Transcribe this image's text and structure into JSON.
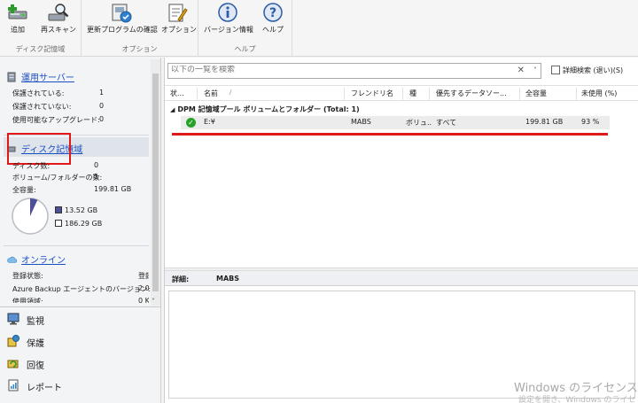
{
  "ribbon": {
    "groups": [
      {
        "caption": "ディスク記憶域",
        "buttons": [
          {
            "label": "追加",
            "icon": "add-disk-icon"
          },
          {
            "label": "再スキャン",
            "icon": "rescan-icon"
          }
        ]
      },
      {
        "caption": "オプション",
        "buttons": [
          {
            "label": "更新プログラムの確認",
            "icon": "check-updates-icon"
          },
          {
            "label": "オプション",
            "icon": "options-icon"
          }
        ]
      },
      {
        "caption": "ヘルプ",
        "buttons": [
          {
            "label": "バージョン情報",
            "icon": "info-icon"
          },
          {
            "label": "ヘルプ",
            "icon": "help-icon"
          }
        ]
      }
    ]
  },
  "left": {
    "servers": {
      "title": "運用サーバー",
      "rows": [
        {
          "label": "保護されている:",
          "value": "1"
        },
        {
          "label": "保護されていない:",
          "value": "0"
        },
        {
          "label": "使用可能なアップグレード:",
          "value": "0"
        }
      ]
    },
    "disk": {
      "title": "ディスク記憶域",
      "rows": [
        {
          "label": "ディスク数:",
          "value": "0"
        },
        {
          "label": "ボリューム/フォルダーの数:",
          "value": "1"
        },
        {
          "label": "全容量:",
          "value": "199.81 GB"
        }
      ],
      "used_label": "13.52 GB",
      "free_label": "186.29 GB",
      "used_fraction": 0.068,
      "used_color": "#4e4f9a"
    },
    "online": {
      "title": "オンライン",
      "rows": [
        {
          "label": "登録状態:",
          "value": "登録"
        },
        {
          "label": "Azure Backup エージェントのバージョン:",
          "value": "2.0"
        },
        {
          "label": "使用領域:",
          "value": "0 K"
        }
      ]
    },
    "nav": [
      {
        "label": "監視",
        "icon": "monitor-icon"
      },
      {
        "label": "保護",
        "icon": "protection-icon"
      },
      {
        "label": "回復",
        "icon": "recovery-icon"
      },
      {
        "label": "レポート",
        "icon": "report-icon"
      }
    ]
  },
  "main": {
    "search_placeholder": "以下の一覧を検索",
    "advanced_search": "詳細検索 (退い)(S)",
    "columns": [
      "状...",
      "名前",
      "フレンドリ名",
      "種",
      "優先するデータソー...",
      "全容量",
      "未使用 (%)"
    ],
    "group_title": "DPM 記憶域プール ボリュームとフォルダー (Total: 1)",
    "rows": [
      {
        "name": "E:¥",
        "friendly": "MABS",
        "type": "ボリュ...",
        "preferred": "すべて",
        "total": "199.81 GB",
        "free": "93 %"
      }
    ],
    "detail_label": "詳細:",
    "detail_value": "MABS"
  },
  "watermark": {
    "line1": "Windows のライセンス認",
    "line2": "設定を開き、Windows のライセ"
  },
  "colors": {
    "accent": "#1a4fc4",
    "highlight": "#e01818",
    "ok": "#27a12a"
  }
}
